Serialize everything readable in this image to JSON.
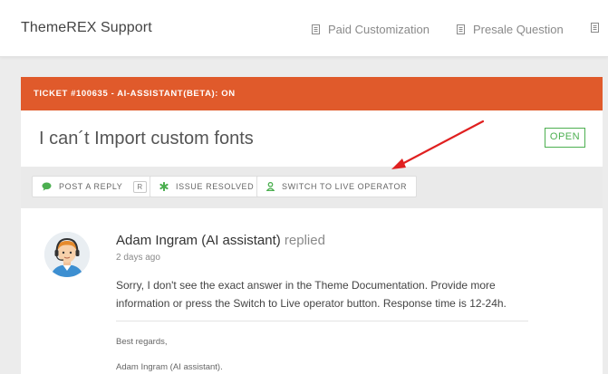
{
  "brand": "ThemeREX Support",
  "nav": [
    {
      "label": "Paid Customization"
    },
    {
      "label": "Presale Question"
    }
  ],
  "ticket": {
    "header": "TICKET #100635 - AI-ASSISTANT(BETA): ON",
    "title": "I can´t Import custom fonts",
    "status": "OPEN"
  },
  "actions": {
    "post_reply": "POST A REPLY",
    "post_reply_key": "R",
    "issue_resolved": "ISSUE RESOLVED",
    "switch_live": "SWITCH TO LIVE OPERATOR"
  },
  "reply": {
    "author": "Adam Ingram (AI assistant)",
    "action": "replied",
    "time": "2 days ago",
    "text": "Sorry, I don't see the exact answer in the Theme Documentation. Provide more information or press the Switch to Live operator button. Response time is 12-24h.",
    "signature_greeting": "Best regards,",
    "signature_name": "Adam Ingram (AI assistant)."
  },
  "colors": {
    "accent_orange": "#e05a2b",
    "status_green": "#4caf50",
    "arrow_red": "#e02020"
  },
  "icons": {
    "nav": "document-icon",
    "post_reply": "chat-bubble-icon",
    "issue_resolved": "asterisk-icon",
    "switch_live": "person-icon",
    "avatar": "operator-headset-avatar"
  }
}
